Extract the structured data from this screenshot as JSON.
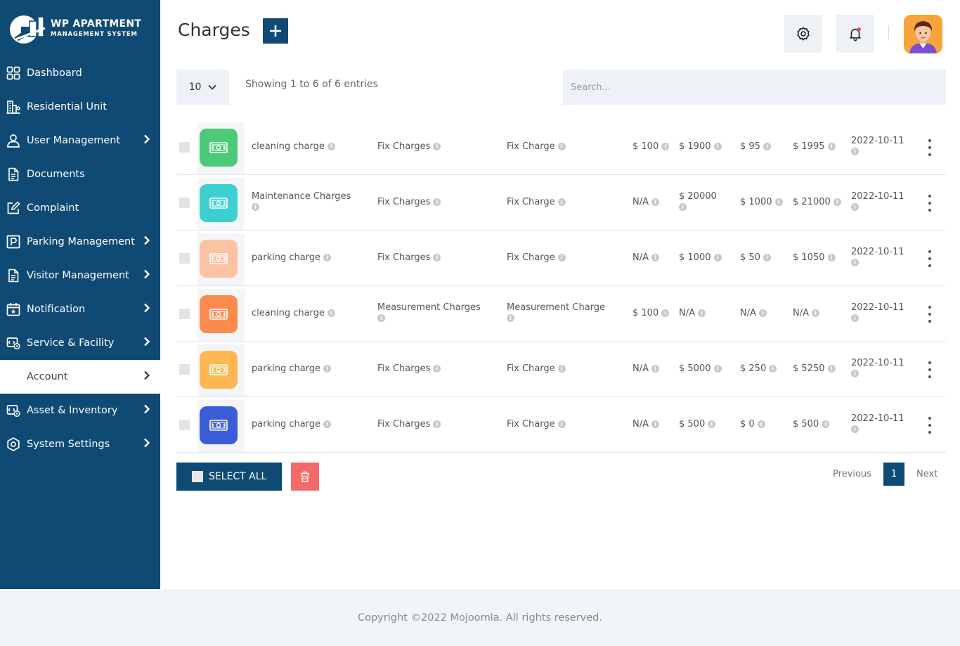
{
  "brand": {
    "title": "WP APARTMENT",
    "subtitle": "MANAGEMENT SYSTEM"
  },
  "sidebar": {
    "items": [
      {
        "label": "Dashboard",
        "icon": "grid-icon",
        "has_chevron": false
      },
      {
        "label": "Residential Unit",
        "icon": "building-icon",
        "has_chevron": false
      },
      {
        "label": "User Management",
        "icon": "user-icon",
        "has_chevron": true
      },
      {
        "label": "Documents",
        "icon": "document-icon",
        "has_chevron": false
      },
      {
        "label": "Complaint",
        "icon": "edit-icon",
        "has_chevron": false
      },
      {
        "label": "Parking Management",
        "icon": "parking-icon",
        "has_chevron": true
      },
      {
        "label": "Visitor Management",
        "icon": "document-icon",
        "has_chevron": true
      },
      {
        "label": "Notification",
        "icon": "calendar-icon",
        "has_chevron": true
      },
      {
        "label": "Service & Facility",
        "icon": "service-icon",
        "has_chevron": true
      },
      {
        "label": "Account",
        "icon": "account-icon",
        "has_chevron": true,
        "active": true
      },
      {
        "label": "Asset & Inventory",
        "icon": "asset-icon",
        "has_chevron": true
      },
      {
        "label": "System Settings",
        "icon": "settings-icon",
        "has_chevron": true
      }
    ]
  },
  "header": {
    "title": "Charges"
  },
  "controls": {
    "page_length": "10",
    "entries_info": "Showing 1 to 6 of 6 entries",
    "search_placeholder": "Search..."
  },
  "table": {
    "rows": [
      {
        "color": "#4cca7a",
        "name": "cleaning charge",
        "category": "Fix Charges",
        "type": "Fix Charge",
        "c1": "$ 100",
        "c2": "$ 1900",
        "c3": "$ 95",
        "c4": "$ 1995",
        "date": "2022-10-11"
      },
      {
        "color": "#3ecfd0",
        "name": "Maintenance Charges",
        "category": "Fix Charges",
        "type": "Fix Charge",
        "c1": "N/A",
        "c2": "$ 20000",
        "c3": "$ 1000",
        "c4": "$ 21000",
        "date": "2022-10-11"
      },
      {
        "color": "#fbc3a1",
        "name": "parking charge",
        "category": "Fix Charges",
        "type": "Fix Charge",
        "c1": "N/A",
        "c2": "$ 1000",
        "c3": "$ 50",
        "c4": "$ 1050",
        "date": "2022-10-11"
      },
      {
        "color": "#fb8a4e",
        "name": "cleaning charge",
        "category": "Measurement Charges",
        "type": "Measurement Charge",
        "c1": "$ 100",
        "c2": "N/A",
        "c3": "N/A",
        "c4": "N/A",
        "date": "2022-10-11"
      },
      {
        "color": "#feb752",
        "name": "parking charge",
        "category": "Fix Charges",
        "type": "Fix Charge",
        "c1": "N/A",
        "c2": "$ 5000",
        "c3": "$ 250",
        "c4": "$ 5250",
        "date": "2022-10-11"
      },
      {
        "color": "#3b5dd8",
        "name": "parking charge",
        "category": "Fix Charges",
        "type": "Fix Charge",
        "c1": "N/A",
        "c2": "$ 500",
        "c3": "$ 0",
        "c4": "$ 500",
        "date": "2022-10-11"
      }
    ]
  },
  "actions": {
    "select_all": "SELECT ALL"
  },
  "pagination": {
    "previous": "Previous",
    "current": "1",
    "next": "Next"
  },
  "footer": {
    "copyright": "Copyright ©2022 Mojoomla. All rights reserved."
  },
  "colors": {
    "primary": "#0f4a74",
    "danger": "#f46a6a",
    "panel": "#eef2f7"
  }
}
